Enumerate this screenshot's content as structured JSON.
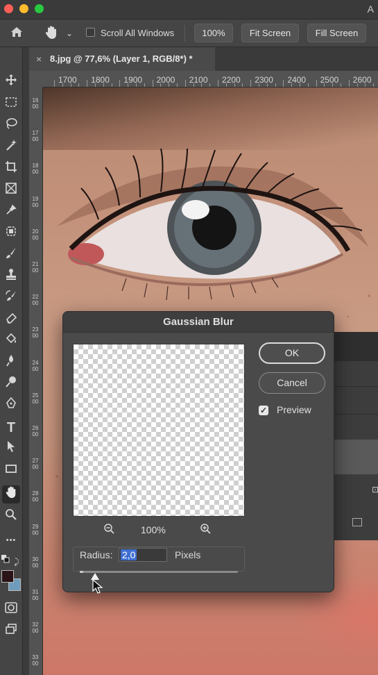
{
  "app": {
    "title_letter": "A"
  },
  "options_bar": {
    "home_icon": "home-icon",
    "hand_icon": "hand-icon",
    "scroll_all_windows_label": "Scroll All Windows",
    "scroll_all_windows_checked": false,
    "zoom_100_label": "100%",
    "fit_screen_label": "Fit Screen",
    "fill_screen_label": "Fill Screen"
  },
  "document_tab": {
    "close_symbol": "×",
    "title": "8.jpg @ 77,6% (Layer 1, RGB/8*) *"
  },
  "ruler": {
    "horizontal": [
      "1700",
      "1800",
      "1900",
      "2000",
      "2100",
      "2200",
      "2300",
      "2400",
      "2500",
      "2600"
    ],
    "vertical": [
      "1600",
      "1700",
      "1800",
      "1900",
      "2000",
      "2100",
      "2200",
      "2300",
      "2400",
      "2500",
      "2600",
      "2700",
      "2800",
      "2900",
      "3000",
      "3100",
      "3200",
      "3300"
    ]
  },
  "toolbar": {
    "tools": [
      "move-tool",
      "marquee-tool",
      "lasso-tool",
      "magic-wand-tool",
      "crop-tool",
      "frame-tool",
      "eyedropper-tool",
      "healing-brush-tool",
      "brush-tool",
      "clone-stamp-tool",
      "history-brush-tool",
      "eraser-tool",
      "paint-bucket-tool",
      "blur-tool",
      "dodge-tool",
      "pen-tool",
      "type-tool",
      "path-selection-tool",
      "rectangle-tool",
      "hand-tool",
      "zoom-tool",
      "more-tools",
      "swap-colors",
      "quick-mask",
      "screen-mode"
    ],
    "active_tool": "hand-tool",
    "type_glyph": "T",
    "more_glyph": "•••",
    "foreground_color": "#2b1418",
    "background_color": "#6f9cbc"
  },
  "dialog": {
    "title": "Gaussian Blur",
    "ok_label": "OK",
    "cancel_label": "Cancel",
    "preview_label": "Preview",
    "preview_checked": true,
    "zoom_percent": "100%",
    "radius_label": "Radius:",
    "radius_value": "2,0",
    "radius_unit": "Pixels",
    "radius_slider_fraction": 0.02
  }
}
